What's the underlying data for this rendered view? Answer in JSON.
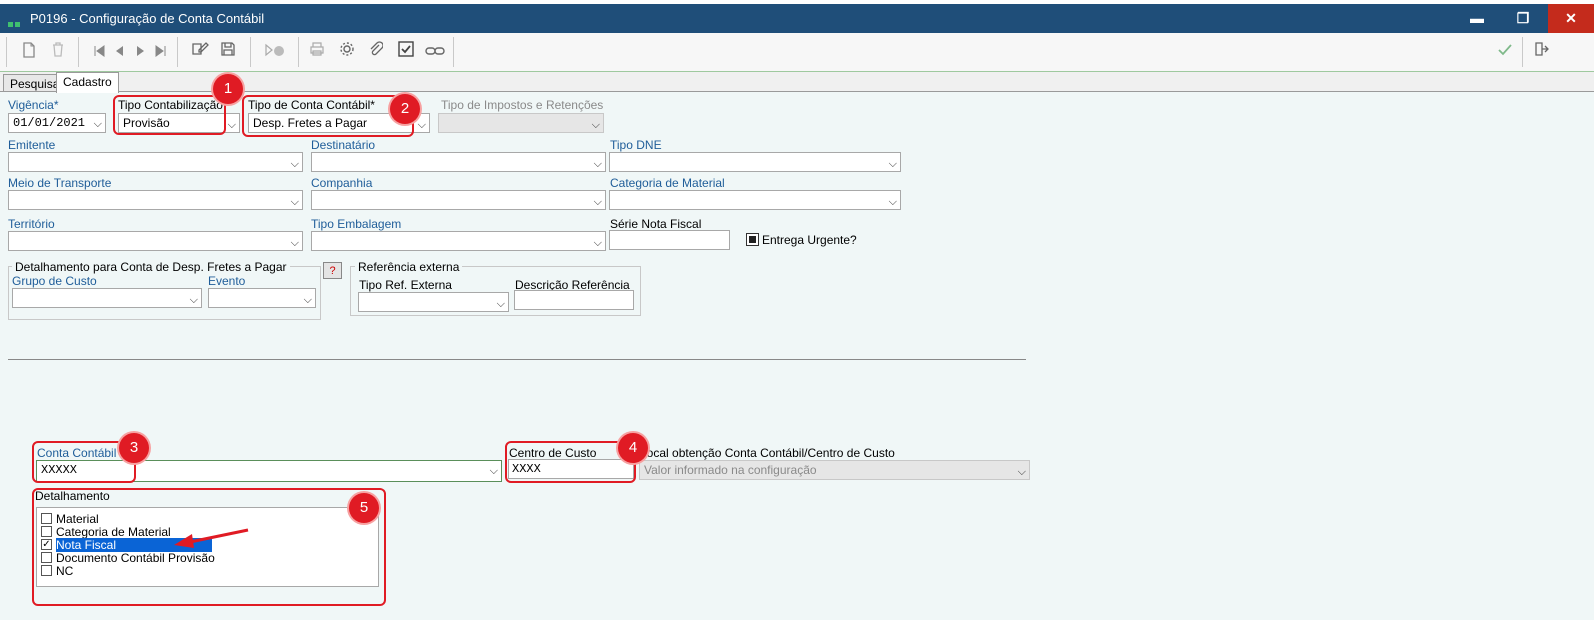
{
  "window": {
    "title": "P0196 - Configuração de Conta Contábil",
    "minimize": "▬",
    "maximize": "❐",
    "close": "✕"
  },
  "tabs": [
    "Pesquisa",
    "Cadastro"
  ],
  "form": {
    "vigencia": {
      "label": "Vigência*",
      "value": "01/01/2021"
    },
    "tipo_contabilizacao": {
      "label": "Tipo Contabilização",
      "value": "Provisão"
    },
    "tipo_conta_contabil": {
      "label": "Tipo de Conta Contábil*",
      "value": "Desp. Fretes a Pagar"
    },
    "tipo_impostos": {
      "label": "Tipo de Impostos e Retenções",
      "value": ""
    },
    "emitente": {
      "label": "Emitente",
      "value": ""
    },
    "destinatario": {
      "label": "Destinatário",
      "value": ""
    },
    "tipo_dne": {
      "label": "Tipo DNE",
      "value": ""
    },
    "meio_transporte": {
      "label": "Meio de Transporte",
      "value": ""
    },
    "companhia": {
      "label": "Companhia",
      "value": ""
    },
    "categoria_material": {
      "label": "Categoria de Material",
      "value": ""
    },
    "territorio": {
      "label": "Território",
      "value": ""
    },
    "tipo_embalagem": {
      "label": "Tipo Embalagem",
      "value": ""
    },
    "serie_nota_fiscal": {
      "label": "Série Nota Fiscal",
      "value": ""
    },
    "entrega_urgente": {
      "label": "Entrega Urgente?",
      "checked": true
    },
    "detalhamento_group": {
      "title": "Detalhamento para Conta de Desp. Fretes a Pagar",
      "grupo_custo": {
        "label": "Grupo de Custo",
        "value": ""
      },
      "evento": {
        "label": "Evento",
        "value": ""
      },
      "help": "?"
    },
    "referencia_externa": {
      "title": "Referência externa",
      "tipo_ref": {
        "label": "Tipo Ref. Externa",
        "value": ""
      },
      "descricao": {
        "label": "Descrição Referência",
        "value": ""
      }
    },
    "conta_contabil": {
      "label": "Conta Contábil",
      "value": "XXXXX"
    },
    "centro_custo": {
      "label": "Centro de Custo",
      "value": "XXXX"
    },
    "local_obtencao": {
      "label": "Local obtenção Conta Contábil/Centro de Custo",
      "value": "Valor informado na configuração"
    },
    "detalhamento": {
      "label": "Detalhamento",
      "items": [
        {
          "label": "Material",
          "checked": false
        },
        {
          "label": "Categoria de Material",
          "checked": false
        },
        {
          "label": "Nota Fiscal",
          "checked": true
        },
        {
          "label": "Documento Contábil Provisão",
          "checked": false
        },
        {
          "label": "NC",
          "checked": false
        }
      ]
    }
  },
  "annotations": [
    "1",
    "2",
    "3",
    "4",
    "5"
  ],
  "icons": {
    "toolbar": [
      "new-icon",
      "delete-icon",
      "first-icon",
      "prev-icon",
      "next-icon",
      "last-icon",
      "edit-icon",
      "save-icon",
      "run-icon",
      "print-icon",
      "gear-icon",
      "attach-icon",
      "check-icon",
      "link-icon"
    ],
    "right": [
      "confirm-icon",
      "exit-icon"
    ]
  },
  "colors": {
    "titlebar": "#1f4e79",
    "annotation": "#e01b24",
    "selection": "#0a64d6"
  }
}
